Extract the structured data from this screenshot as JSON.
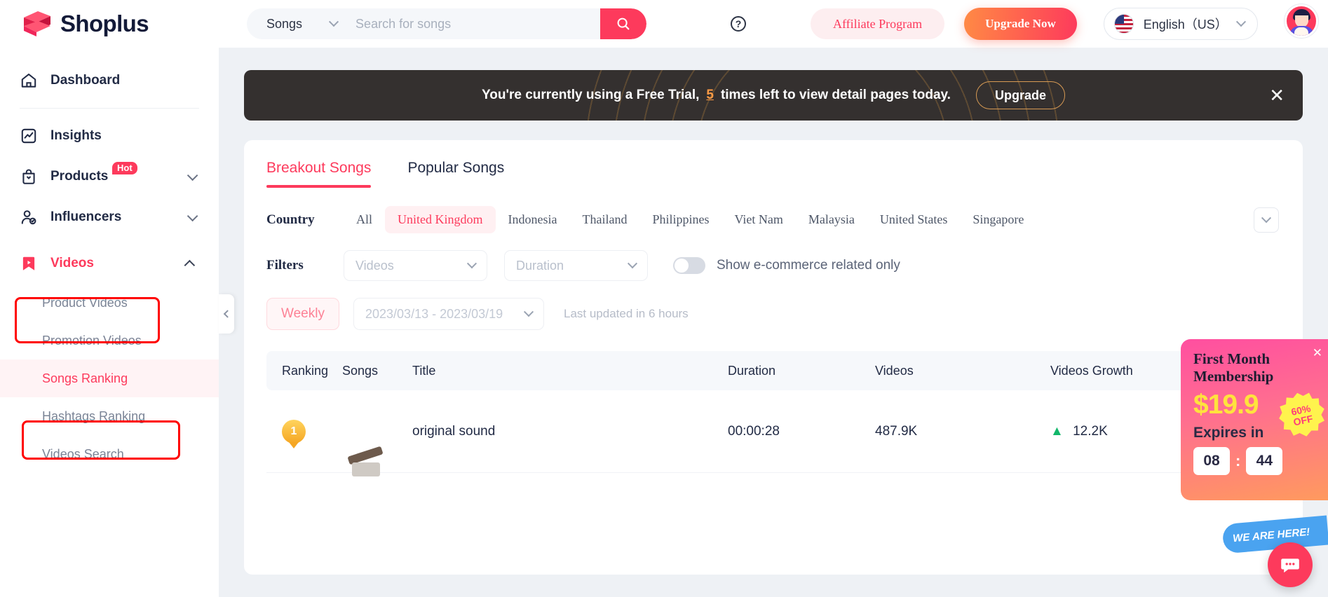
{
  "brand": {
    "name": "Shoplus"
  },
  "header": {
    "search": {
      "category": "Songs",
      "placeholder": "Search for songs",
      "value": ""
    },
    "help_icon": "?",
    "affiliate_label": "Affiliate Program",
    "upgrade_label": "Upgrade Now",
    "language": "English（US）"
  },
  "banner": {
    "text_before": "You're currently using a Free Trial,",
    "count": "5",
    "text_after": "times left to view detail pages today.",
    "upgrade_label": "Upgrade",
    "close_label": "✕"
  },
  "sidebar": {
    "items": [
      {
        "label": "Dashboard",
        "icon": "home-icon",
        "badge": "",
        "caret": ""
      },
      {
        "label": "Insights",
        "icon": "chart-icon",
        "badge": "",
        "caret": ""
      },
      {
        "label": "Products",
        "icon": "bag-icon",
        "badge": "Hot",
        "caret": "down"
      },
      {
        "label": "Influencers",
        "icon": "user-check-icon",
        "badge": "",
        "caret": "down"
      },
      {
        "label": "Videos",
        "icon": "bookmark-play-icon",
        "badge": "",
        "caret": "up"
      }
    ],
    "sub_items": [
      {
        "label": "Product Videos"
      },
      {
        "label": "Promotion Videos"
      },
      {
        "label": "Songs Ranking"
      },
      {
        "label": "Hashtags Ranking"
      },
      {
        "label": "Videos Search"
      }
    ]
  },
  "tabs": [
    {
      "label": "Breakout Songs",
      "active": true
    },
    {
      "label": "Popular Songs",
      "active": false
    }
  ],
  "filters": {
    "country_label": "Country",
    "countries": [
      {
        "label": "All",
        "selected": false
      },
      {
        "label": "United Kingdom",
        "selected": true
      },
      {
        "label": "Indonesia",
        "selected": false
      },
      {
        "label": "Thailand",
        "selected": false
      },
      {
        "label": "Philippines",
        "selected": false
      },
      {
        "label": "Viet Nam",
        "selected": false
      },
      {
        "label": "Malaysia",
        "selected": false
      },
      {
        "label": "United States",
        "selected": false
      },
      {
        "label": "Singapore",
        "selected": false
      }
    ],
    "filters_label": "Filters",
    "videos_select": "Videos",
    "duration_select": "Duration",
    "toggle_label": "Show e-commerce related only",
    "weekly_label": "Weekly",
    "date_range": "2023/03/13 - 2023/03/19",
    "last_updated": "Last updated in 6 hours"
  },
  "table": {
    "columns": [
      "Ranking",
      "Songs",
      "Title",
      "Duration",
      "Videos",
      "Videos Growth"
    ],
    "rows": [
      {
        "rank": "1",
        "title": "original sound",
        "duration": "00:00:28",
        "videos": "487.9K",
        "growth": "12.2K",
        "growth_dir": "▲"
      }
    ]
  },
  "promo": {
    "title": "First Month Membership",
    "price": "$19.9",
    "discount_pct": "60%",
    "discount_text": "OFF",
    "expires_label": "Expires in",
    "hours": "08",
    "separator": ":",
    "minutes": "44",
    "close_label": "✕",
    "we_are_here": "WE ARE HERE!"
  },
  "colors": {
    "accent": "#fd3a5c",
    "banner_bg": "#34302f",
    "highlight": "#ff0000",
    "growth_up": "#12b76a"
  }
}
